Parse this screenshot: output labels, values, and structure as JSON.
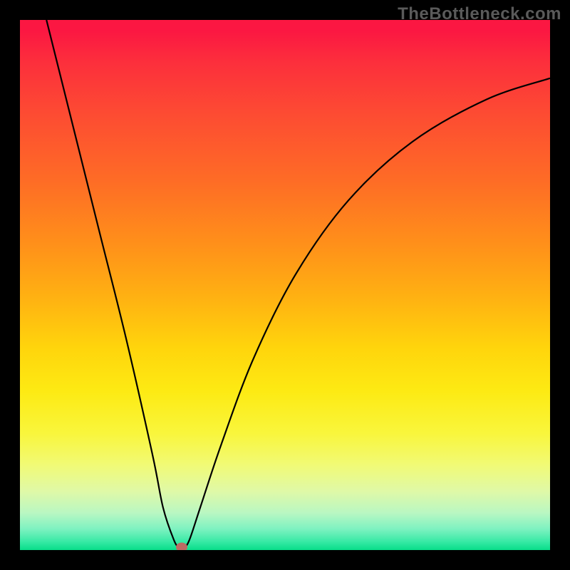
{
  "watermark": "TheBottleneck.com",
  "chart_data": {
    "type": "line",
    "title": "",
    "xlabel": "",
    "ylabel": "",
    "xlim": [
      0,
      100
    ],
    "ylim": [
      0,
      100
    ],
    "grid": false,
    "series": [
      {
        "name": "curve",
        "x": [
          5,
          10,
          15,
          20,
          25,
          27,
          29,
          30,
          31,
          32,
          34,
          38,
          44,
          52,
          62,
          74,
          88,
          100
        ],
        "values": [
          100,
          80,
          60,
          40,
          18,
          8,
          2,
          0.5,
          0.5,
          2,
          8,
          20,
          36,
          52,
          66,
          77,
          85,
          89
        ]
      }
    ],
    "marker": {
      "x": 30.5,
      "y": 0.5
    },
    "background_gradient": {
      "orientation": "vertical",
      "stops": [
        {
          "pos": 0.0,
          "color": "#fb1742"
        },
        {
          "pos": 0.3,
          "color": "#fe6b26"
        },
        {
          "pos": 0.62,
          "color": "#ffd50c"
        },
        {
          "pos": 0.84,
          "color": "#f1fa76"
        },
        {
          "pos": 1.0,
          "color": "#08de89"
        }
      ]
    }
  }
}
